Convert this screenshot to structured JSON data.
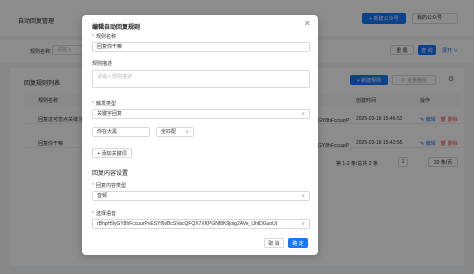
{
  "background": {
    "page_title": "自动回复管理",
    "top_button": "+ 新建公众号",
    "account_select": "我的公众号",
    "filter_label": "规则名称:",
    "filter_placeholder": "请输入",
    "reset_label": "重 置",
    "query_label": "查 询",
    "expand_label": "展开 ∨",
    "list_title": "回复规则列表",
    "add_rule_label": "+ 新建规则",
    "batch_delete_label": "⊘ 批量删除",
    "columns": [
      "规则名称",
      "创建时间",
      "操作"
    ],
    "rows": [
      {
        "name": "回复这可您点关缝注单",
        "media_tail": "GY8hFccuurP",
        "time": "2025-03-18 15:46:52",
        "edit": "编辑",
        "delete": "删除"
      },
      {
        "name": "回复你干嘛",
        "media_tail": "GY8hFccuurP",
        "time": "2025-03-18 15:42:55",
        "edit": "编辑",
        "delete": "删除"
      }
    ],
    "pagination": {
      "total": "第 1-2 条/总共 2 条",
      "page": "1",
      "page_size": "20 条/页"
    }
  },
  "modal": {
    "title": "编辑自动回复规则",
    "rule_name_label": "规则名称",
    "rule_name_value": "回复你干嘛",
    "rule_desc_label": "规则描述",
    "rule_desc_placeholder": "请输入规则描述",
    "trigger_type_label": "触发类型",
    "trigger_type_value": "关键字回复",
    "keyword_value": "你在大黑",
    "match_type_value": "全匹配",
    "add_keyword_label": "+ 添加关键词",
    "section_title": "回复内容设置",
    "content_type_label": "回复内容类型",
    "content_type_value": "音频",
    "select_audio_label": "选择语音",
    "select_audio_value": "rBhpH9yGY8hFccuurPvESYf6vBcSVacQFQX7XKPGNf8K9joig2AVe_UhtDGuoUt",
    "cancel_label": "取 消",
    "ok_label": "确 定"
  }
}
